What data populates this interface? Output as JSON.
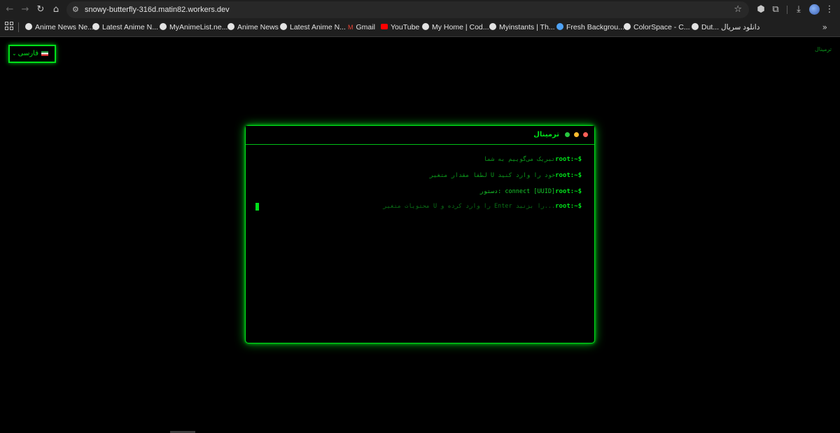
{
  "browser": {
    "url": "snowy-butterfly-316d.matin82.workers.dev",
    "bookmarks": [
      "Anime News Ne...",
      "Latest Anime N...",
      "MyAnimeList.ne...",
      "Anime News",
      "Latest Anime N...",
      "Gmail",
      "YouTube",
      "My Home | Cod...",
      "Myinstants | Th...",
      "Fresh Backgrou...",
      "ColorSpace - C...",
      "Dut... دانلود سریال"
    ],
    "bookmarks_more": "»"
  },
  "page": {
    "language_select": {
      "label": "فارسی",
      "flag": "Iran flag"
    },
    "corner_label": "ترمینال"
  },
  "terminal": {
    "title": "ترمینال",
    "lines": [
      {
        "prompt": "root:~$",
        "text": "تبریک می‌گوییم به شما"
      },
      {
        "prompt": "root:~$",
        "text": "لطفا مقدار متغیر U خود را وارد کنید"
      },
      {
        "prompt": "root:~$",
        "text": "دستور: connect [UUID]"
      },
      {
        "prompt": "root:~$",
        "text": "محتویات متغیر U را وارد کرده و Enter را بزنید..."
      }
    ]
  },
  "colors": {
    "accent": "#00e01a",
    "background": "#000000"
  }
}
